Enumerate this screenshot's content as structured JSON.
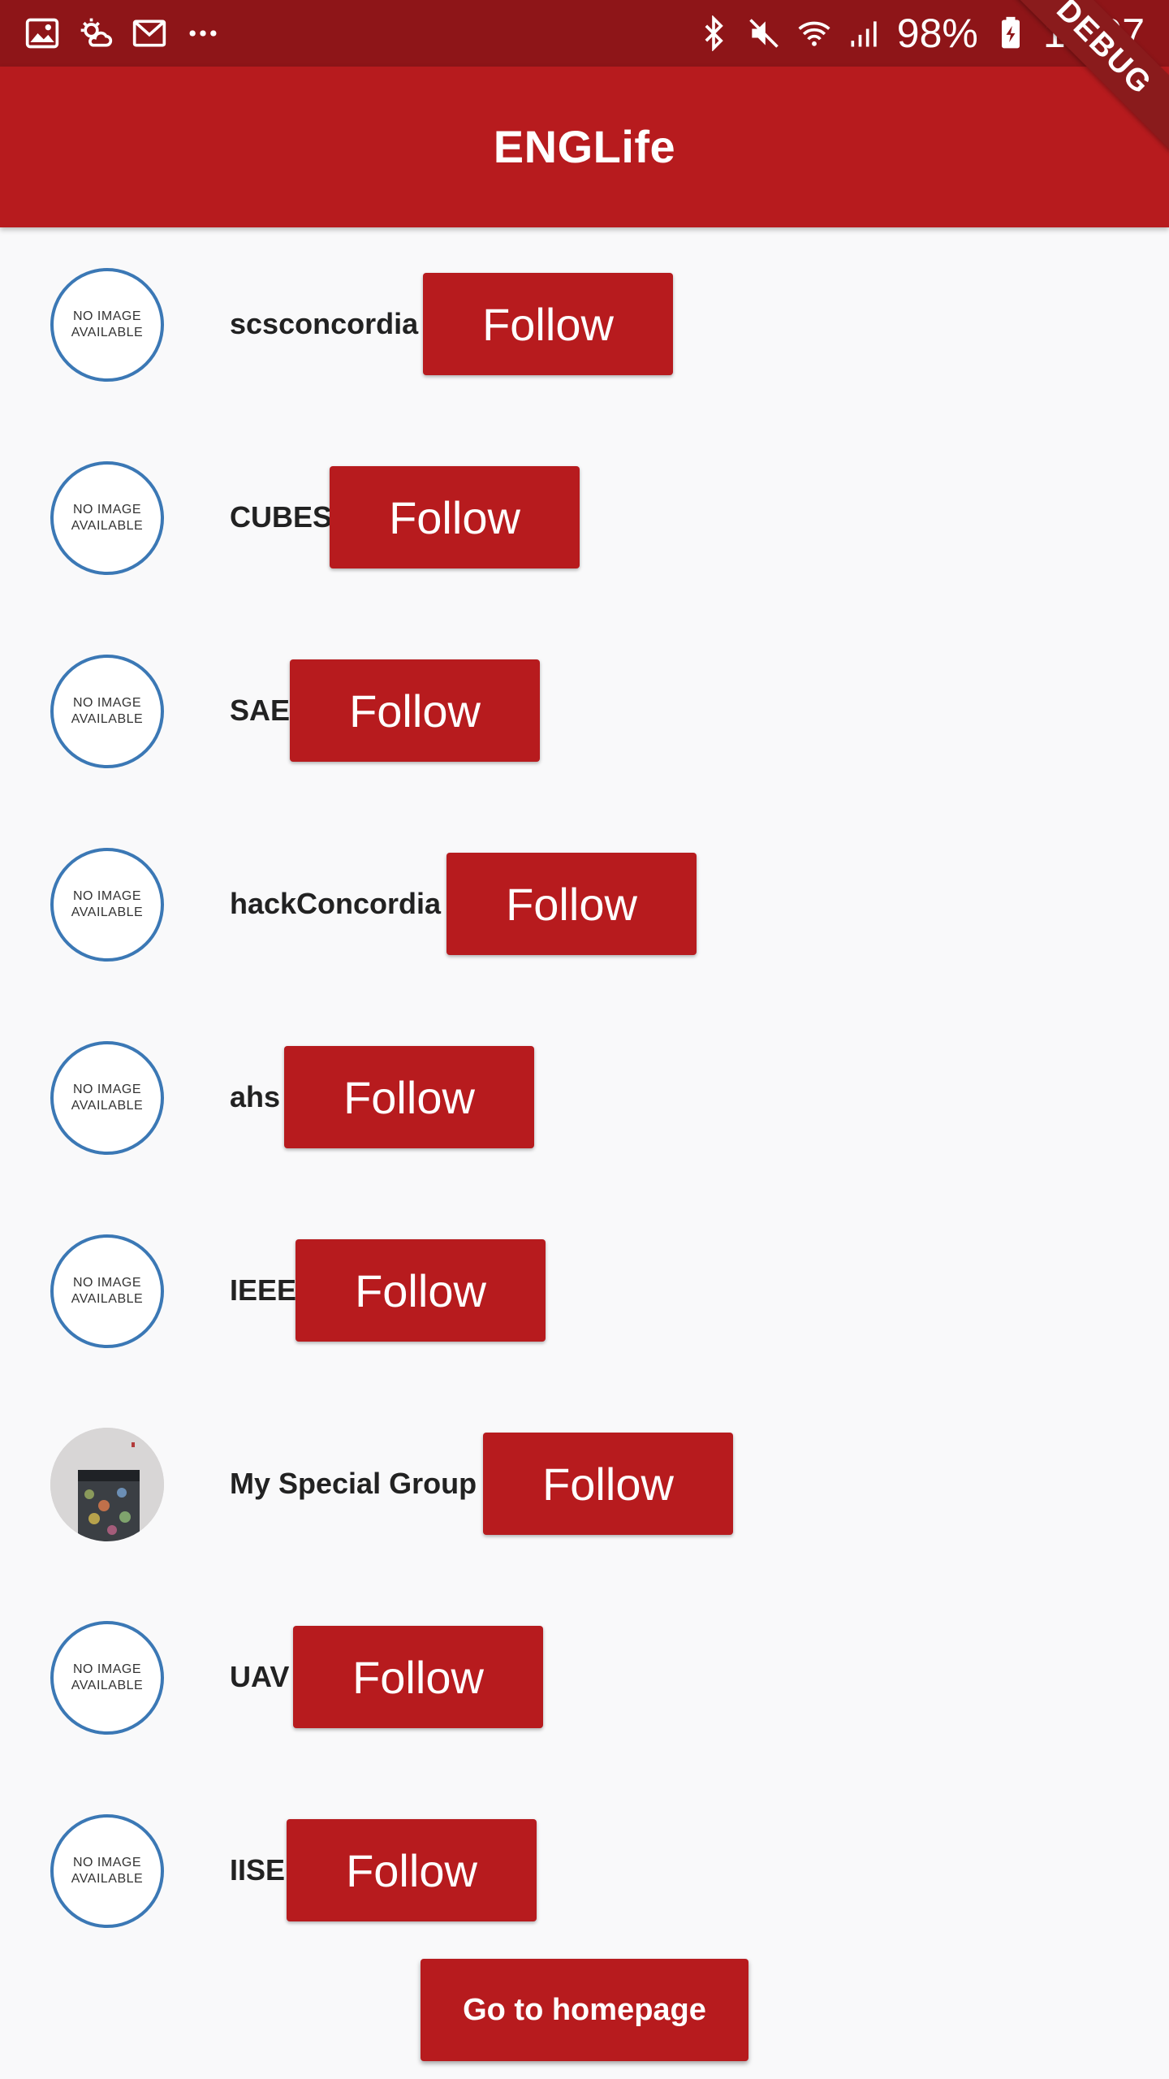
{
  "status_bar": {
    "icons_left": [
      "gallery-icon",
      "weather-icon",
      "gmail-icon",
      "more-dots-icon"
    ],
    "icons_right": [
      "bluetooth-icon",
      "mute-icon",
      "wifi-icon",
      "signal-icon",
      "battery-charging-icon"
    ],
    "battery": "98%",
    "time": "10:07"
  },
  "debug_banner": "DEBUG",
  "app_bar": {
    "title": "ENGLife"
  },
  "groups": [
    {
      "name": "scsconcordia",
      "follow_label": "Follow",
      "avatar": "NO IMAGE AVAILABLE"
    },
    {
      "name": "CUBES",
      "follow_label": "Follow",
      "avatar": "NO IMAGE AVAILABLE"
    },
    {
      "name": "SAE",
      "follow_label": "Follow",
      "avatar": "NO IMAGE AVAILABLE"
    },
    {
      "name": "hackConcordia",
      "follow_label": "Follow",
      "avatar": "NO IMAGE AVAILABLE"
    },
    {
      "name": "ahs",
      "follow_label": "Follow",
      "avatar": "NO IMAGE AVAILABLE"
    },
    {
      "name": "IEEE",
      "follow_label": "Follow",
      "avatar": "NO IMAGE AVAILABLE"
    },
    {
      "name": "My Special Group",
      "follow_label": "Follow",
      "avatar": "photo"
    },
    {
      "name": "UAV",
      "follow_label": "Follow",
      "avatar": "NO IMAGE AVAILABLE"
    },
    {
      "name": "IISE",
      "follow_label": "Follow",
      "avatar": "NO IMAGE AVAILABLE"
    }
  ],
  "home_button": {
    "label": "Go to homepage"
  },
  "colors": {
    "status_bar": "#8e1518",
    "app_bar": "#b71b1e",
    "button": "#b71b1e",
    "avatar_border": "#3b78b5",
    "background": "#f9f9fa"
  }
}
